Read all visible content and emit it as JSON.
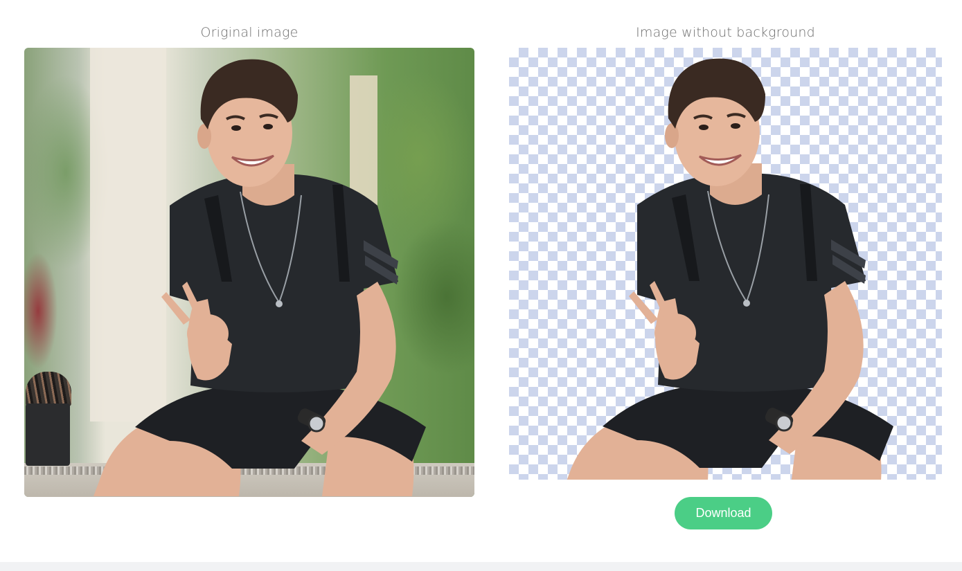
{
  "panels": {
    "original": {
      "title": "Original image"
    },
    "result": {
      "title": "Image without background"
    }
  },
  "actions": {
    "download_label": "Download"
  },
  "colors": {
    "accent": "#4bce86",
    "checker": "#ccd5ec",
    "title_text": "#6d6d6d",
    "footer": "#f1f2f4"
  },
  "icons": []
}
